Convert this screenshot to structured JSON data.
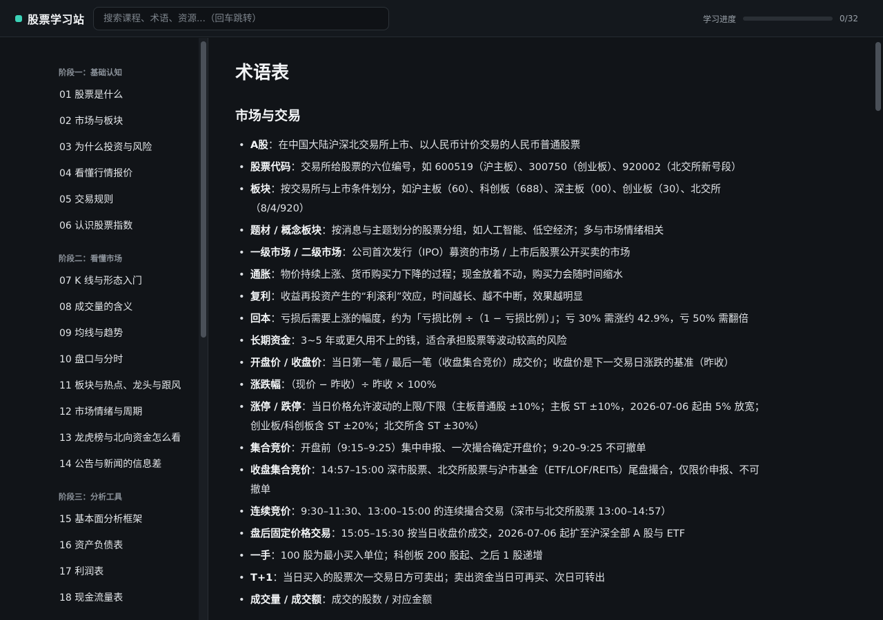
{
  "header": {
    "brand": "股票学习站",
    "search_placeholder": "搜索课程、术语、资源...（回车跳转）",
    "progress_label": "学习进度",
    "progress_count": "0/32",
    "progress_fraction": 0
  },
  "sidebar": {
    "stages": [
      {
        "title": "阶段一：基础认知",
        "items": [
          "01 股票是什么",
          "02 市场与板块",
          "03 为什么投资与风险",
          "04 看懂行情报价",
          "05 交易规则",
          "06 认识股票指数"
        ]
      },
      {
        "title": "阶段二：看懂市场",
        "items": [
          "07 K 线与形态入门",
          "08 成交量的含义",
          "09 均线与趋势",
          "10 盘口与分时",
          "11 板块与热点、龙头与跟风",
          "12 市场情绪与周期",
          "13 龙虎榜与北向资金怎么看",
          "14 公告与新闻的信息差"
        ]
      },
      {
        "title": "阶段三：分析工具",
        "items": [
          "15 基本面分析框架",
          "16 资产负债表",
          "17 利润表",
          "18 现金流量表"
        ]
      }
    ]
  },
  "main": {
    "title": "术语表",
    "section": "市场与交易",
    "terms": [
      {
        "term": "A股",
        "def": "：在中国大陆沪深北交易所上市、以人民币计价交易的人民币普通股票"
      },
      {
        "term": "股票代码",
        "def": "：交易所给股票的六位编号，如 600519（沪主板）、300750（创业板）、920002（北交所新号段）"
      },
      {
        "term": "板块",
        "def": "：按交易所与上市条件划分，如沪主板（60）、科创板（688）、深主板（00）、创业板（30）、北交所（8/4/920）"
      },
      {
        "term": "题材 / 概念板块",
        "def": "：按消息与主题划分的股票分组，如人工智能、低空经济；多与市场情绪相关"
      },
      {
        "term": "一级市场 / 二级市场",
        "def": "：公司首次发行（IPO）募资的市场 / 上市后股票公开买卖的市场"
      },
      {
        "term": "通胀",
        "def": "：物价持续上涨、货币购买力下降的过程；现金放着不动，购买力会随时间缩水"
      },
      {
        "term": "复利",
        "def": "：收益再投资产生的“利滚利”效应，时间越长、越不中断，效果越明显"
      },
      {
        "term": "回本",
        "def": "：亏损后需要上涨的幅度，约为「亏损比例 ÷（1 − 亏损比例）」；亏 30% 需涨约 42.9%，亏 50% 需翻倍"
      },
      {
        "term": "长期资金",
        "def": "：3~5 年或更久用不上的钱，适合承担股票等波动较高的风险"
      },
      {
        "term": "开盘价 / 收盘价",
        "def": "：当日第一笔 / 最后一笔（收盘集合竞价）成交价；收盘价是下一交易日涨跌的基准（昨收）"
      },
      {
        "term": "涨跌幅",
        "def": "：（现价 − 昨收）÷ 昨收 × 100%"
      },
      {
        "term": "涨停 / 跌停",
        "def": "：当日价格允许波动的上限/下限（主板普通股 ±10%；主板 ST ±10%，2026-07-06 起由 5% 放宽；创业板/科创板含 ST ±20%；北交所含 ST ±30%）"
      },
      {
        "term": "集合竞价",
        "def": "：开盘前（9:15–9:25）集中申报、一次撮合确定开盘价；9:20–9:25 不可撤单"
      },
      {
        "term": "收盘集合竞价",
        "def": "：14:57–15:00 深市股票、北交所股票与沪市基金（ETF/LOF/REITs）尾盘撮合，仅限价申报、不可撤单"
      },
      {
        "term": "连续竞价",
        "def": "：9:30–11:30、13:00–15:00 的连续撮合交易（深市与北交所股票 13:00–14:57）"
      },
      {
        "term": "盘后固定价格交易",
        "def": "：15:05–15:30 按当日收盘价成交，2026-07-06 起扩至沪深全部 A 股与 ETF"
      },
      {
        "term": "一手",
        "def": "：100 股为最小买入单位；科创板 200 股起、之后 1 股递增"
      },
      {
        "term": "T+1",
        "def": "：当日买入的股票次一交易日方可卖出；卖出资金当日可再买、次日可转出"
      },
      {
        "term": "成交量 / 成交额",
        "def": "：成交的股数 / 对应金额"
      }
    ]
  }
}
